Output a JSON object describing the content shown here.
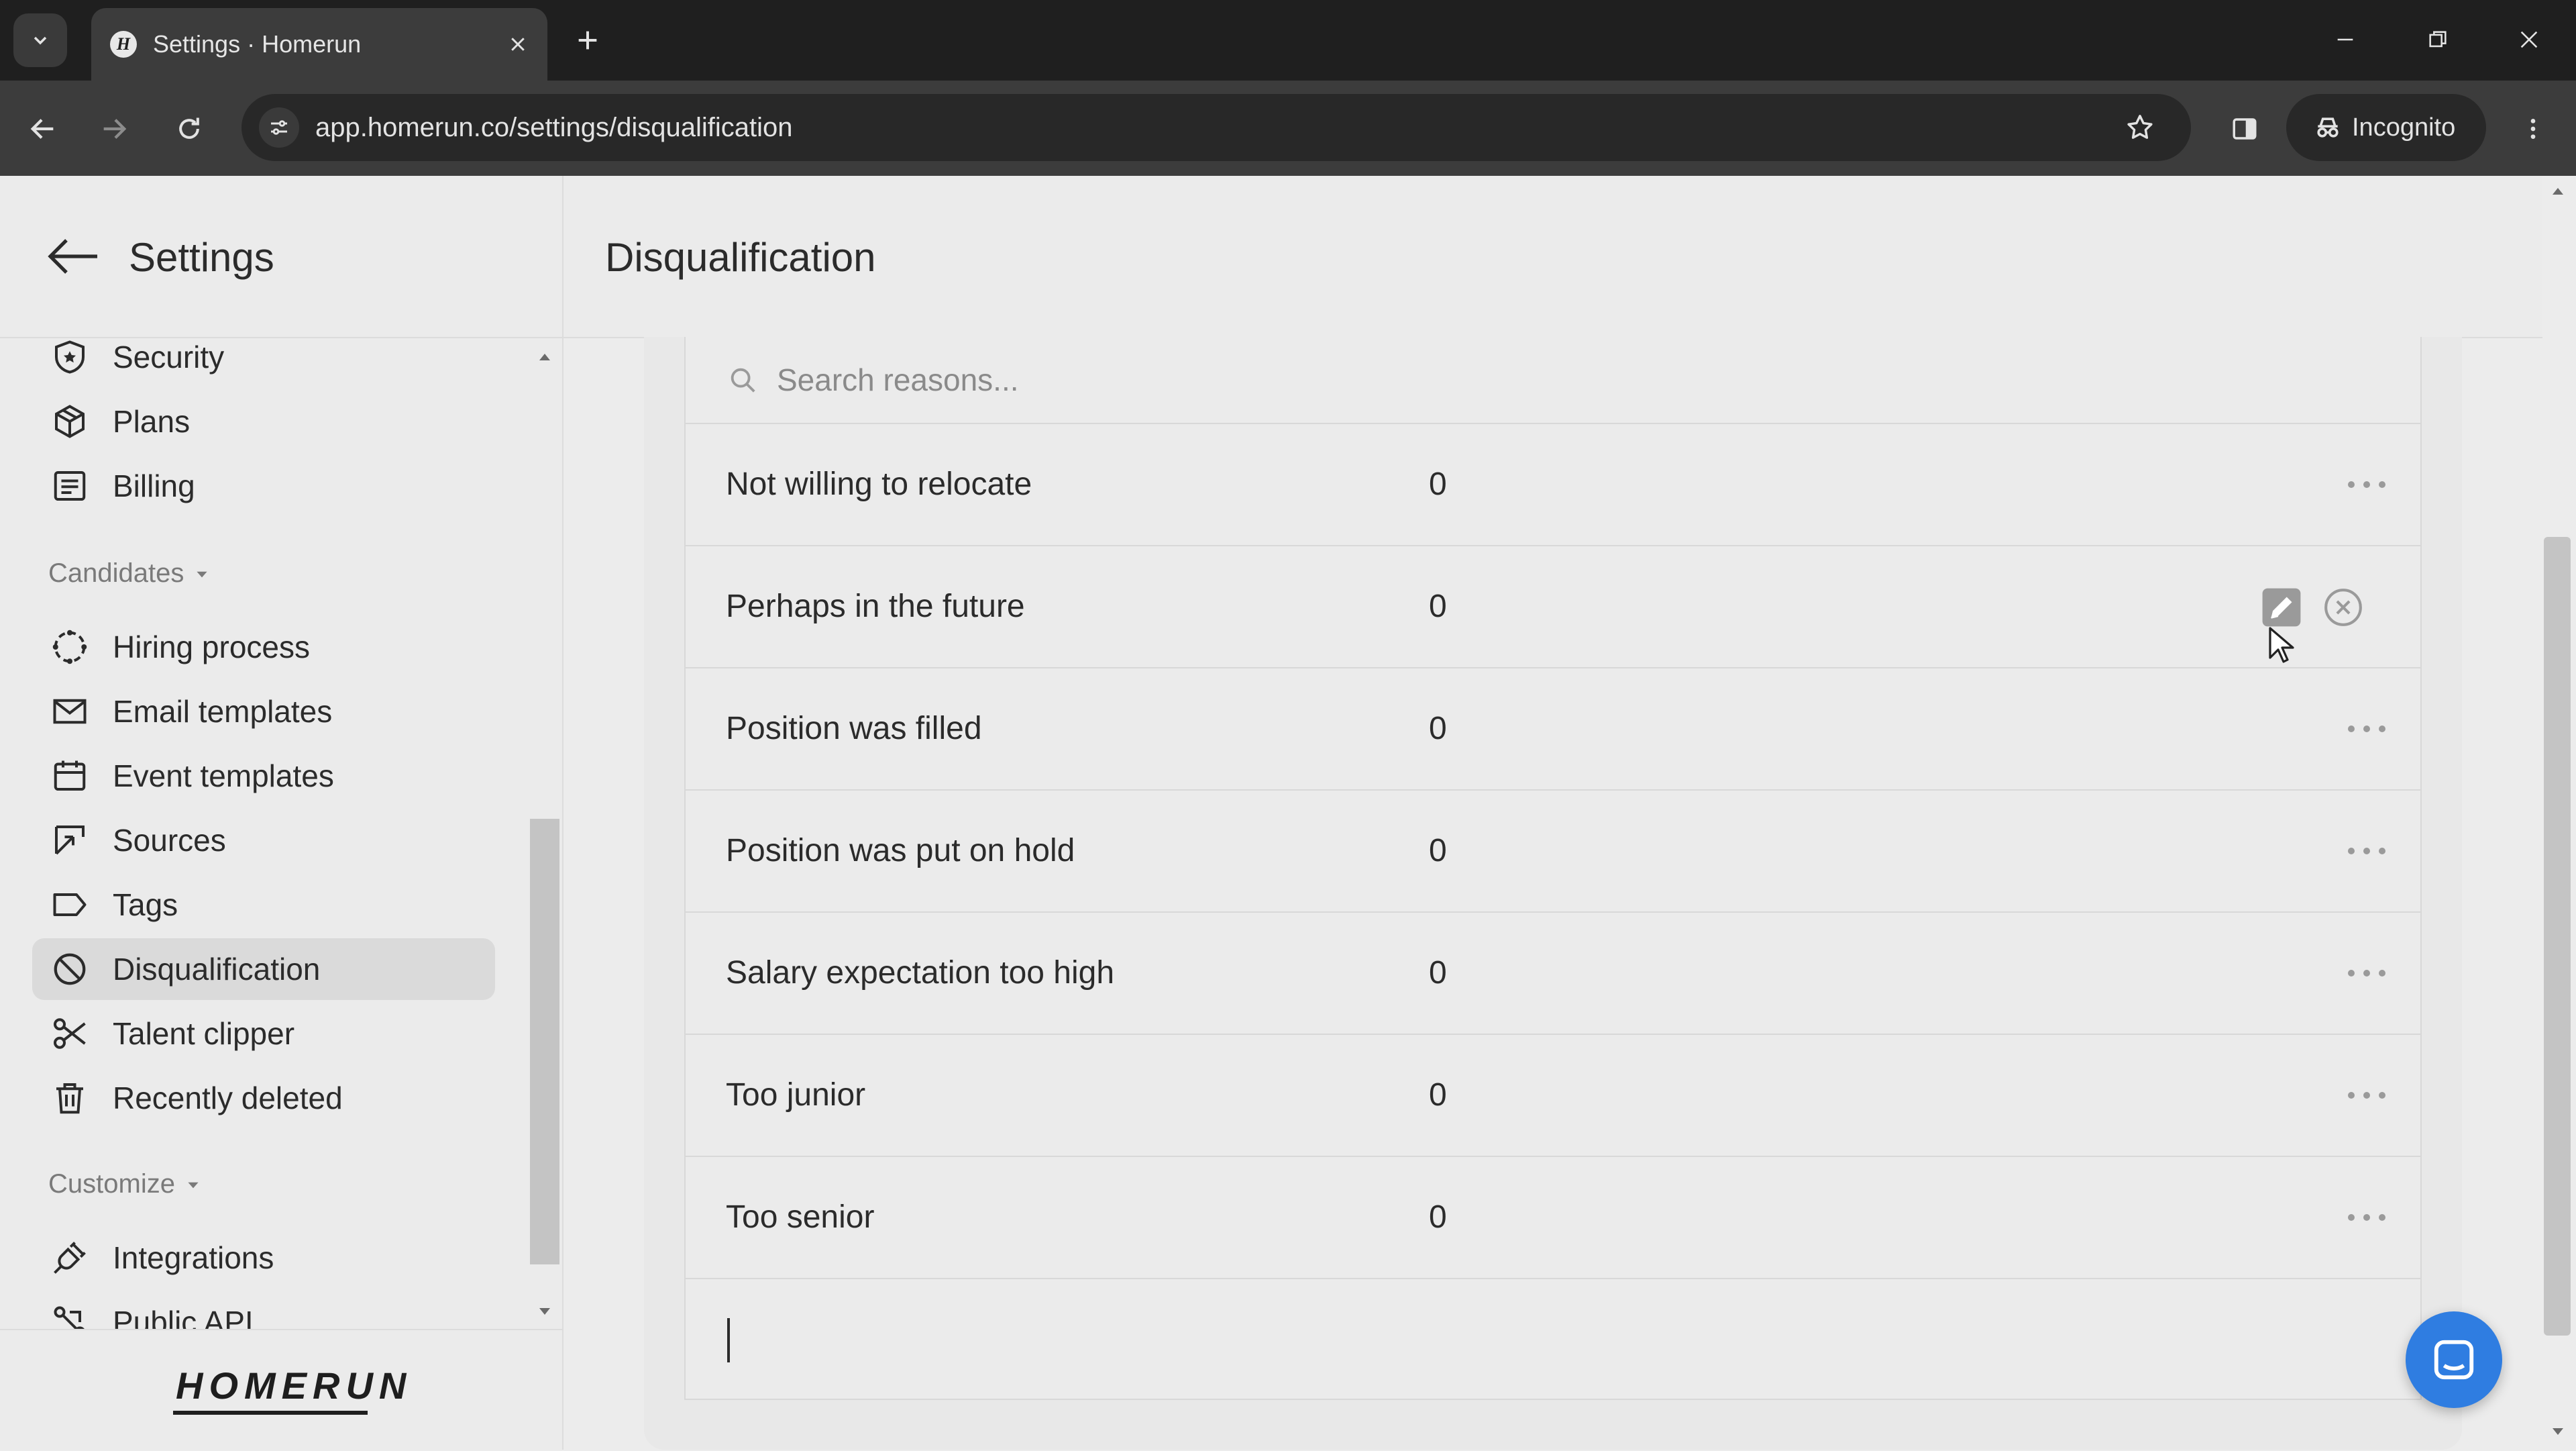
{
  "browser": {
    "tab_title": "Settings · Homerun",
    "favicon_letter": "H",
    "url": "app.homerun.co/settings/disqualification",
    "incognito_label": "Incognito"
  },
  "sidebar": {
    "title": "Settings",
    "items_top": [
      {
        "label": "Security",
        "icon": "shield-star-icon"
      },
      {
        "label": "Plans",
        "icon": "package-icon"
      },
      {
        "label": "Billing",
        "icon": "receipt-icon"
      }
    ],
    "candidates_label": "Candidates",
    "candidates_items": [
      {
        "label": "Hiring process",
        "icon": "process-circle-icon"
      },
      {
        "label": "Email templates",
        "icon": "envelope-icon"
      },
      {
        "label": "Event templates",
        "icon": "calendar-icon"
      },
      {
        "label": "Sources",
        "icon": "source-icon"
      },
      {
        "label": "Tags",
        "icon": "tag-icon"
      },
      {
        "label": "Disqualification",
        "icon": "ban-icon",
        "active": true
      },
      {
        "label": "Talent clipper",
        "icon": "scissors-icon"
      },
      {
        "label": "Recently deleted",
        "icon": "trash-icon"
      }
    ],
    "customize_label": "Customize",
    "customize_items": [
      {
        "label": "Integrations",
        "icon": "plug-icon"
      },
      {
        "label": "Public API",
        "icon": "api-icon"
      }
    ],
    "logo_text": "HOMERUN"
  },
  "main": {
    "page_title": "Disqualification",
    "search_placeholder": "Search reasons...",
    "reasons": [
      {
        "name": "Not willing to relocate",
        "count": "0"
      },
      {
        "name": "Perhaps in the future",
        "count": "0",
        "hovered": true
      },
      {
        "name": "Position was filled",
        "count": "0"
      },
      {
        "name": "Position was put on hold",
        "count": "0"
      },
      {
        "name": "Salary expectation too high",
        "count": "0"
      },
      {
        "name": "Too junior",
        "count": "0"
      },
      {
        "name": "Too senior",
        "count": "0"
      }
    ]
  },
  "colors": {
    "accent_chat": "#2f7de1",
    "active_nav_bg": "#dadada",
    "chrome_dark": "#1f1f1f"
  }
}
